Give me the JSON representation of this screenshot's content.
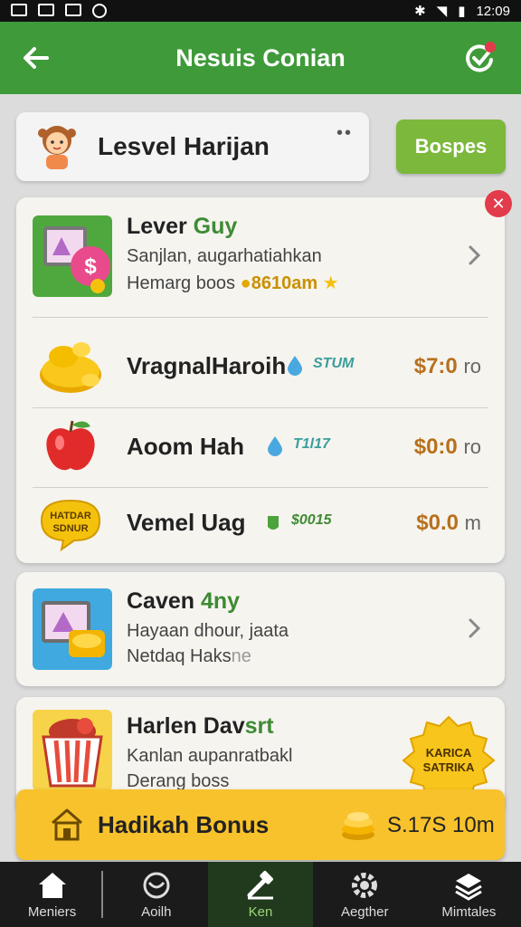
{
  "status_bar": {
    "time": "12:09"
  },
  "app_bar": {
    "title": "Nesuis Conian"
  },
  "level_card": {
    "name": "Lesvel Harijan",
    "more": "••"
  },
  "action_button": {
    "label": "Bospes"
  },
  "featured": {
    "title_a": "Lever",
    "title_b": "Guy",
    "subtitle": "Sanjlan, augarhatiahkan",
    "line2_text": "Hemarg boos",
    "line2_value": "8610am"
  },
  "list_items": [
    {
      "name": "VragnalHaroih",
      "tag": "STUM",
      "price": "$7:0",
      "unit": "ro"
    },
    {
      "name": "Aoom Hah",
      "tag": "T1l17",
      "price": "$0:0",
      "unit": "ro"
    },
    {
      "name": "Vemel Uag",
      "tag": "$0015",
      "price": "$0.0",
      "unit": "m"
    }
  ],
  "stamp_text": {
    "line1": "HATDAR",
    "line2": "SDNUR"
  },
  "card2": {
    "title_a": "Caven",
    "title_b": "4ny",
    "line1": "Hayaan dhour, jaata",
    "line2_a": "Netdaq Haks",
    "line2_b": "ne"
  },
  "card3": {
    "title_a": "Harlen Dav",
    "title_b": "srt",
    "line1": "Kanlan aupanratbakl",
    "line2": "Derang boss"
  },
  "badge": {
    "line1": "KARICA",
    "line2": "SATRIKA"
  },
  "bonus": {
    "label": "Hadikah Bonus",
    "value": "S.17S 10m"
  },
  "nav": [
    {
      "label": "Meniers",
      "icon": "home-icon"
    },
    {
      "label": "Aoilh",
      "icon": "ring-icon"
    },
    {
      "label": "Ken",
      "icon": "hammer-icon"
    },
    {
      "label": "Aegther",
      "icon": "gear-icon"
    },
    {
      "label": "Mimtales",
      "icon": "stack-icon"
    }
  ],
  "colors": {
    "appbar": "#3f9a3a",
    "accent_green": "#7cb83c",
    "bonus_yellow": "#f8c22c",
    "price_brown": "#b8701d",
    "close_red": "#e23b4b"
  }
}
